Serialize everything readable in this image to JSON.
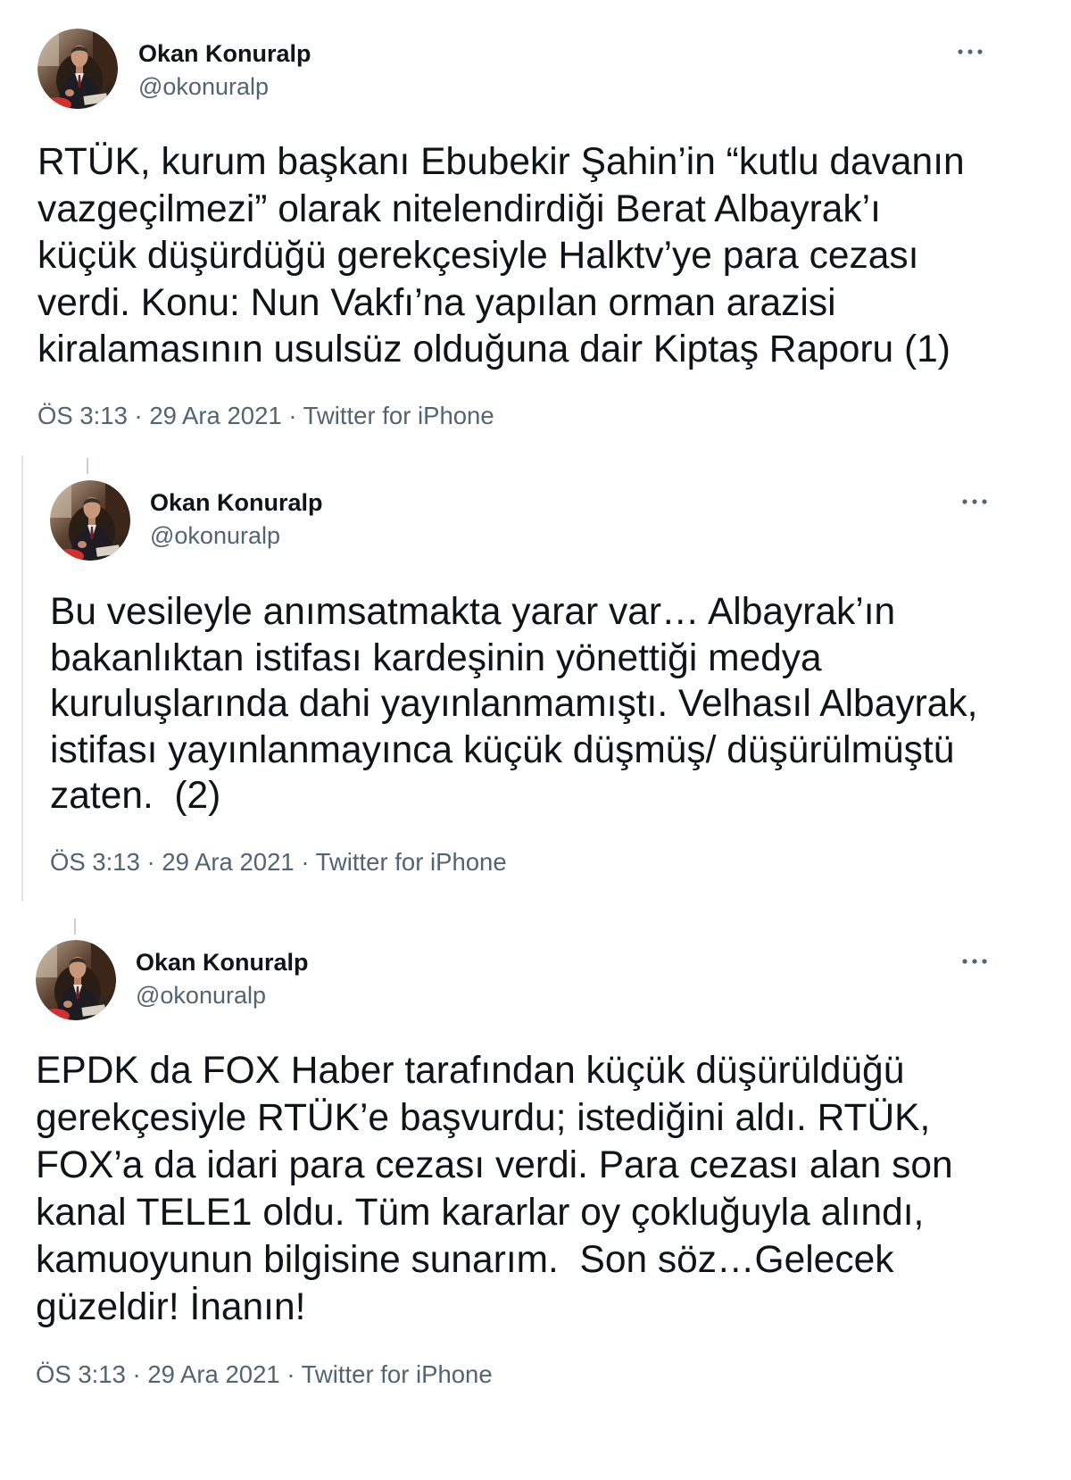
{
  "colors": {
    "text": "#0f1419",
    "secondary": "#536471",
    "border": "#e3e6e8",
    "background": "#ffffff"
  },
  "icons": {
    "more": "more-horizontal-icon",
    "avatar": "profile-photo"
  },
  "meta_separator": "·",
  "tweets": [
    {
      "author": {
        "name": "Okan Konuralp",
        "handle": "@okonuralp"
      },
      "lines": [
        "RTÜK, kurum başkanı Ebubekir Şahin’in “kutlu davanın",
        "vazgeçilmezi” olarak nitelendirdiği Berat Albayrak’ı",
        "küçük düşürdüğü gerekçesiyle Halktv’ye para cezası",
        "verdi. Konu: Nun Vakfı’na yapılan orman arazisi",
        "kiralamasının usulsüz olduğuna dair Kiptaş Raporu (1)"
      ],
      "timestamp": "ÖS 3:13 · 29 Ara 2021",
      "source": "Twitter for iPhone"
    },
    {
      "author": {
        "name": "Okan Konuralp",
        "handle": "@okonuralp"
      },
      "lines": [
        "Bu vesileyle anımsatmakta yarar var… Albayrak’ın",
        "bakanlıktan istifası kardeşinin yönettiği medya",
        "kuruluşlarında dahi yayınlanmamıştı. Velhasıl Albayrak,",
        "istifası yayınlanmayınca küçük düşmüş/ düşürülmüştü",
        "zaten.  (2)"
      ],
      "timestamp": "ÖS 3:13 · 29 Ara 2021",
      "source": "Twitter for iPhone"
    },
    {
      "author": {
        "name": "Okan Konuralp",
        "handle": "@okonuralp"
      },
      "lines": [
        "EPDK da FOX Haber tarafından küçük düşürüldüğü",
        "gerekçesiyle RTÜK’e başvurdu; istediğini aldı. RTÜK,",
        "FOX’a da idari para cezası verdi. Para cezası alan son",
        "kanal TELE1 oldu. Tüm kararlar oy çokluğuyla alındı,",
        "kamuoyunun bilgisine sunarım.  Son söz…Gelecek",
        "güzeldir! İnanın!"
      ],
      "timestamp": "ÖS 3:13 · 29 Ara 2021",
      "source": "Twitter for iPhone"
    }
  ]
}
